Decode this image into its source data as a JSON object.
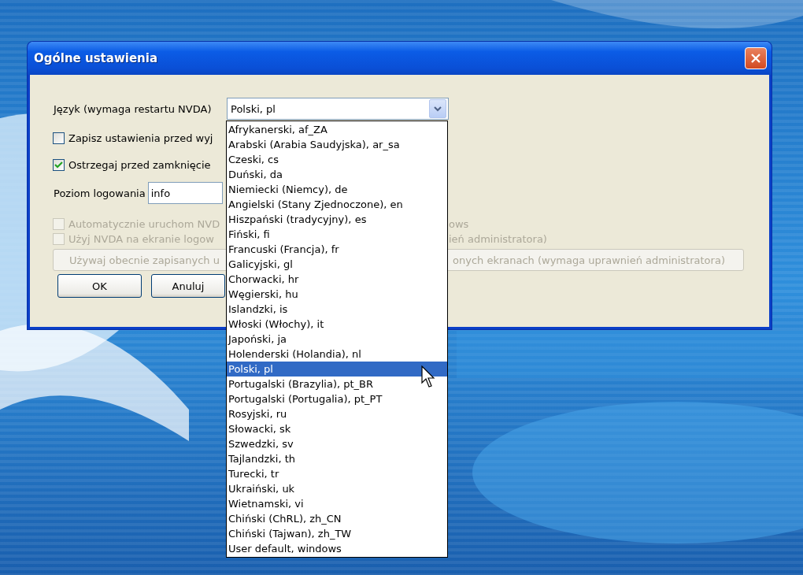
{
  "window": {
    "title": "Ogólne ustawienia"
  },
  "language": {
    "label": "Język (wymaga restartu NVDA)",
    "value": "Polski, pl",
    "expanded": true,
    "options": [
      {
        "label": "Afrykanerski, af_ZA",
        "selected": false
      },
      {
        "label": "Arabski (Arabia Saudyjska), ar_sa",
        "selected": false
      },
      {
        "label": "Czeski, cs",
        "selected": false
      },
      {
        "label": "Duński, da",
        "selected": false
      },
      {
        "label": "Niemiecki (Niemcy), de",
        "selected": false
      },
      {
        "label": "Angielski (Stany Zjednoczone), en",
        "selected": false
      },
      {
        "label": "Hiszpański (tradycyjny), es",
        "selected": false
      },
      {
        "label": "Fiński, fi",
        "selected": false
      },
      {
        "label": "Francuski (Francja), fr",
        "selected": false
      },
      {
        "label": "Galicyjski, gl",
        "selected": false
      },
      {
        "label": "Chorwacki, hr",
        "selected": false
      },
      {
        "label": "Węgierski, hu",
        "selected": false
      },
      {
        "label": "Islandzki, is",
        "selected": false
      },
      {
        "label": "Włoski (Włochy), it",
        "selected": false
      },
      {
        "label": "Japoński, ja",
        "selected": false
      },
      {
        "label": "Holenderski (Holandia), nl",
        "selected": false
      },
      {
        "label": "Polski, pl",
        "selected": true
      },
      {
        "label": "Portugalski (Brazylia), pt_BR",
        "selected": false
      },
      {
        "label": "Portugalski (Portugalia), pt_PT",
        "selected": false
      },
      {
        "label": "Rosyjski, ru",
        "selected": false
      },
      {
        "label": "Słowacki, sk",
        "selected": false
      },
      {
        "label": "Szwedzki, sv",
        "selected": false
      },
      {
        "label": "Tajlandzki, th",
        "selected": false
      },
      {
        "label": "Turecki, tr",
        "selected": false
      },
      {
        "label": "Ukraiński, uk",
        "selected": false
      },
      {
        "label": "Wietnamski, vi",
        "selected": false
      },
      {
        "label": "Chiński (ChRL), zh_CN",
        "selected": false
      },
      {
        "label": "Chiński (Tajwan), zh_TW",
        "selected": false
      },
      {
        "label": "User default, windows",
        "selected": false
      }
    ]
  },
  "checkboxes": [
    {
      "label": "Zapisz ustawienia przed wyj",
      "checked": false,
      "disabled": false
    },
    {
      "label": "Ostrzegaj przed zamknięcie",
      "checked": true,
      "disabled": false
    }
  ],
  "logging": {
    "label": "Poziom logowania",
    "value": "info"
  },
  "system_checkboxes": [
    {
      "label": "Automatycznie uruchom NVD",
      "label_continued": "ows",
      "checked": false,
      "disabled": true
    },
    {
      "label": "Użyj NVDA na ekranie logow",
      "label_continued": "ień administratora)",
      "checked": false,
      "disabled": true
    }
  ],
  "copy_button": {
    "label": "Używaj obecnie zapisanych u",
    "label_continued": "onych ekranach (wymaga uprawnień administratora)",
    "disabled": true
  },
  "buttons": [
    "OK",
    "Anuluj"
  ]
}
